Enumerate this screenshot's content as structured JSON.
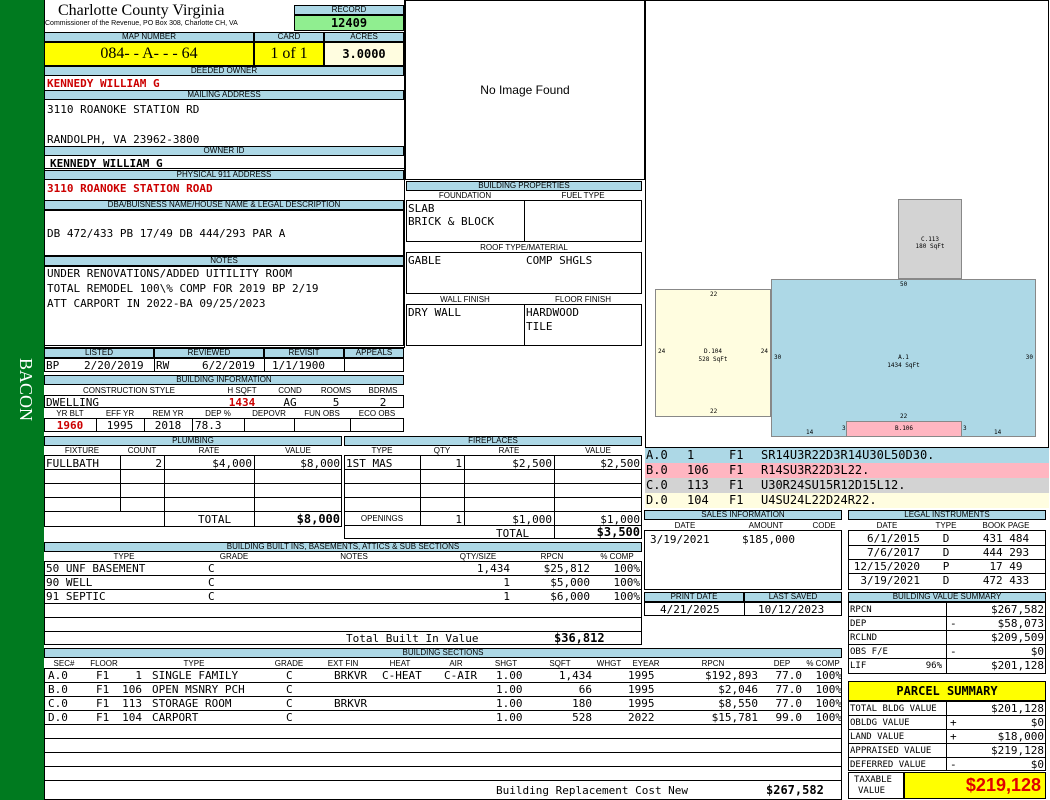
{
  "sidebar": {
    "text": "BACON",
    "color": "#007a1f"
  },
  "header": {
    "county": "Charlotte County Virginia",
    "address": "Commissioner of the Revenue, PO Box 308, Charlotte CH, VA"
  },
  "record": {
    "label": "RECORD",
    "value": "12409"
  },
  "map": {
    "label": "MAP NUMBER",
    "value": "084- - A- - - 64"
  },
  "card": {
    "label": "CARD",
    "value": "1 of 1"
  },
  "acres": {
    "label": "ACRES",
    "value": "3.0000"
  },
  "deeded_owner": {
    "label": "DEEDED OWNER",
    "value": "KENNEDY WILLIAM G"
  },
  "mailing": {
    "label": "MAILING ADDRESS",
    "line1": "3110 ROANOKE STATION RD",
    "line2": "RANDOLPH, VA 23962-3800"
  },
  "owner_id": {
    "label": "OWNER ID",
    "value": "KENNEDY WILLIAM G"
  },
  "physical": {
    "label": "PHYSICAL 911 ADDRESS",
    "value": "3110 ROANOKE STATION ROAD"
  },
  "dba": {
    "label": "DBA/BUISNESS NAME/HOUSE NAME & LEGAL DESCRIPTION",
    "value": "DB 472/433 PB 17/49 DB 444/293 PAR A"
  },
  "notes": {
    "label": "NOTES",
    "lines": [
      "UNDER RENOVATIONS/ADDED UITILITY ROOM",
      "TOTAL REMODEL 100\\% COMP FOR 2019 BP 2/19",
      "ATT CARPORT IN 2022-BA 09/25/2023"
    ]
  },
  "dates": {
    "listed_label": "LISTED",
    "listed_code": "BP",
    "listed": "2/20/2019",
    "reviewed_label": "REVIEWED",
    "reviewed_code": "RW",
    "reviewed": "6/2/2019",
    "revisit_label": "REVISIT",
    "revisit": "1/1/1900",
    "appeals_label": "APPEALS",
    "appeals": ""
  },
  "building_info": {
    "label": "BUILDING INFORMATION",
    "h_style": "CONSTRUCTION STYLE",
    "h_sqft": "H SQFT",
    "h_cond": "COND",
    "h_rooms": "ROOMS",
    "h_bdrms": "BDRMS",
    "style": "DWELLING",
    "sqft": "1434",
    "cond": "AG",
    "rooms": "5",
    "bdrms": "2",
    "h_yrblt": "YR BLT",
    "h_effyr": "EFF YR",
    "h_remyr": "REM YR",
    "h_dep": "DEP %",
    "h_depovr": "DEPOVR",
    "h_funobs": "FUN OBS",
    "h_ecoobs": "ECO OBS",
    "yrblt": "1960",
    "effyr": "1995",
    "remyr": "2018",
    "dep": "78.3",
    "depovr": "",
    "funobs": "",
    "ecoobs": ""
  },
  "image_panel": {
    "text": "No Image Found"
  },
  "building_properties": {
    "label": "BUILDING PROPERTIES",
    "foundation_label": "FOUNDATION",
    "fuel_label": "FUEL TYPE",
    "foundation": [
      "SLAB",
      "BRICK & BLOCK"
    ],
    "fuel": "",
    "roof_label": "ROOF TYPE/MATERIAL",
    "roof_type": "GABLE",
    "roof_material": "COMP SHGLS",
    "wall_label": "WALL FINISH",
    "floor_label": "FLOOR FINISH",
    "wall": "DRY WALL",
    "floor": [
      "HARDWOOD",
      "TILE"
    ]
  },
  "sketch": {
    "c": {
      "name": "C.113",
      "area": "180 SqFt",
      "color": "#d3d3d3"
    },
    "a": {
      "name": "A.1",
      "area": "1434 SqFt",
      "color": "#add8e6",
      "top": "50",
      "side": "30",
      "right": "30",
      "bottom1": "22",
      "bottom2": "14",
      "bottom3": "3",
      "bottom4": "3",
      "bottom5": "14"
    },
    "d": {
      "name": "D.104",
      "area": "528 SqFt",
      "color": "#fffde0",
      "top": "22",
      "left": "24",
      "right": "24",
      "bottom": "22"
    },
    "b": {
      "name": "B.106",
      "color": "#ffb6c1"
    }
  },
  "sketch_legend": [
    {
      "code": "A.0",
      "num": "1",
      "fl": "F1",
      "desc": "SR14U3R22D3R14U30L50D30.",
      "color": "#add8e6"
    },
    {
      "code": "B.0",
      "num": "106",
      "fl": "F1",
      "desc": "R14SU3R22D3L22.",
      "color": "#ffb6c1"
    },
    {
      "code": "C.0",
      "num": "113",
      "fl": "F1",
      "desc": "U30R24SU15R12D15L12.",
      "color": "#d3d3d3"
    },
    {
      "code": "D.0",
      "num": "104",
      "fl": "F1",
      "desc": "U4SU24L22D24R22.",
      "color": "#fffde0"
    }
  ],
  "plumbing": {
    "label": "PLUMBING",
    "h_fixture": "FIXTURE",
    "h_count": "COUNT",
    "h_rate": "RATE",
    "h_value": "VALUE",
    "rows": [
      {
        "fixture": "FULLBATH",
        "count": "2",
        "rate": "$4,000",
        "value": "$8,000"
      }
    ],
    "total_label": "TOTAL",
    "total": "$8,000"
  },
  "fireplaces": {
    "label": "FIREPLACES",
    "h_type": "TYPE",
    "h_qty": "QTY",
    "h_rate": "RATE",
    "h_value": "VALUE",
    "rows": [
      {
        "type": "1ST MAS",
        "qty": "1",
        "rate": "$2,500",
        "value": "$2,500"
      }
    ],
    "openings_label": "OPENINGS",
    "openings_qty": "1",
    "openings_rate": "$1,000",
    "openings_value": "$1,000",
    "total_label": "TOTAL",
    "total": "$3,500"
  },
  "sales": {
    "label": "SALES INFORMATION",
    "h_date": "DATE",
    "h_amount": "AMOUNT",
    "h_code": "CODE",
    "rows": [
      {
        "date": "3/19/2021",
        "amount": "$185,000",
        "code": ""
      }
    ]
  },
  "legal": {
    "label": "LEGAL INSTRUMENTS",
    "h_date": "DATE",
    "h_type": "TYPE",
    "h_book": "BOOK PAGE",
    "rows": [
      {
        "date": "6/1/2015",
        "type": "D",
        "book": "431 484"
      },
      {
        "date": "7/6/2017",
        "type": "D",
        "book": "444 293"
      },
      {
        "date": "12/15/2020",
        "type": "P",
        "book": "17 49"
      },
      {
        "date": "3/19/2021",
        "type": "D",
        "book": "472 433"
      }
    ]
  },
  "print": {
    "print_label": "PRINT DATE",
    "print_date": "4/21/2025",
    "saved_label": "LAST SAVED",
    "saved_date": "10/12/2023"
  },
  "value_summary": {
    "label": "BUILDING VALUE SUMMARY",
    "rows": [
      {
        "label": "RPCN",
        "sign": "",
        "value": "$267,582"
      },
      {
        "label": "DEP",
        "sign": "-",
        "value": "$58,073"
      },
      {
        "label": "RCLND",
        "sign": "",
        "value": "$209,509"
      },
      {
        "label": "OBS F/E",
        "sign": "-",
        "value": "$0"
      },
      {
        "label": "LIF",
        "sign": "96%",
        "value": "$201,128"
      }
    ]
  },
  "built_ins": {
    "label": "BUILDING BUILT INS, BASEMENTS, ATTICS & SUB SECTIONS",
    "h_type": "TYPE",
    "h_grade": "GRADE",
    "h_notes": "NOTES",
    "h_qty": "QTY/SIZE",
    "h_rpcn": "RPCN",
    "h_comp": "% COMP",
    "rows": [
      {
        "type": "50 UNF BASEMENT",
        "grade": "C",
        "notes": "",
        "qty": "1,434",
        "rpcn": "$25,812",
        "comp": "100%"
      },
      {
        "type": "90 WELL",
        "grade": "C",
        "notes": "",
        "qty": "1",
        "rpcn": "$5,000",
        "comp": "100%"
      },
      {
        "type": "91 SEPTIC",
        "grade": "C",
        "notes": "",
        "qty": "1",
        "rpcn": "$6,000",
        "comp": "100%"
      }
    ],
    "total_label": "Total Built In Value",
    "total": "$36,812"
  },
  "sections": {
    "label": "BUILDING SECTIONS",
    "h_sec": "SEC#",
    "h_floor": "FLOOR",
    "h_type": "TYPE",
    "h_grade": "GRADE",
    "h_extfin": "EXT FIN",
    "h_heat": "HEAT",
    "h_air": "AIR",
    "h_shgt": "SHGT",
    "h_sqft": "SQFT",
    "h_whgt": "WHGT",
    "h_eyear": "EYEAR",
    "h_rpcn": "RPCN",
    "h_dep": "DEP",
    "h_comp": "% COMP",
    "rows": [
      {
        "sec": "A.0",
        "floor": "F1",
        "code": "1",
        "type": "SINGLE FAMILY",
        "grade": "C",
        "extfin": "BRKVR",
        "heat": "C-HEAT",
        "air": "C-AIR",
        "shgt": "1.00",
        "sqft": "1,434",
        "whgt": "",
        "eyear": "1995",
        "rpcn": "$192,893",
        "dep": "77.0",
        "comp": "100%"
      },
      {
        "sec": "B.0",
        "floor": "F1",
        "code": "106",
        "type": "OPEN MSNRY PCH",
        "grade": "C",
        "extfin": "",
        "heat": "",
        "air": "",
        "shgt": "1.00",
        "sqft": "66",
        "whgt": "",
        "eyear": "1995",
        "rpcn": "$2,046",
        "dep": "77.0",
        "comp": "100%"
      },
      {
        "sec": "C.0",
        "floor": "F1",
        "code": "113",
        "type": "STORAGE ROOM",
        "grade": "C",
        "extfin": "BRKVR",
        "heat": "",
        "air": "",
        "shgt": "1.00",
        "sqft": "180",
        "whgt": "",
        "eyear": "1995",
        "rpcn": "$8,550",
        "dep": "77.0",
        "comp": "100%"
      },
      {
        "sec": "D.0",
        "floor": "F1",
        "code": "104",
        "type": "CARPORT",
        "grade": "C",
        "extfin": "",
        "heat": "",
        "air": "",
        "shgt": "1.00",
        "sqft": "528",
        "whgt": "",
        "eyear": "2022",
        "rpcn": "$15,781",
        "dep": "99.0",
        "comp": "100%"
      }
    ],
    "total_label": "Building Replacement Cost New",
    "total": "$267,582"
  },
  "parcel": {
    "label": "PARCEL SUMMARY",
    "rows": [
      {
        "label": "TOTAL BLDG VALUE",
        "sign": "",
        "value": "$201,128"
      },
      {
        "label": "OBLDG VALUE",
        "sign": "+",
        "value": "$0"
      },
      {
        "label": "LAND VALUE",
        "sign": "+",
        "value": "$18,000"
      },
      {
        "label": "APPRAISED VALUE",
        "sign": "",
        "value": "$219,128"
      },
      {
        "label": "DEFERRED VALUE",
        "sign": "-",
        "value": "$0"
      }
    ],
    "taxable_label1": "TAXABLE",
    "taxable_label2": "VALUE",
    "taxable": "$219,128"
  }
}
